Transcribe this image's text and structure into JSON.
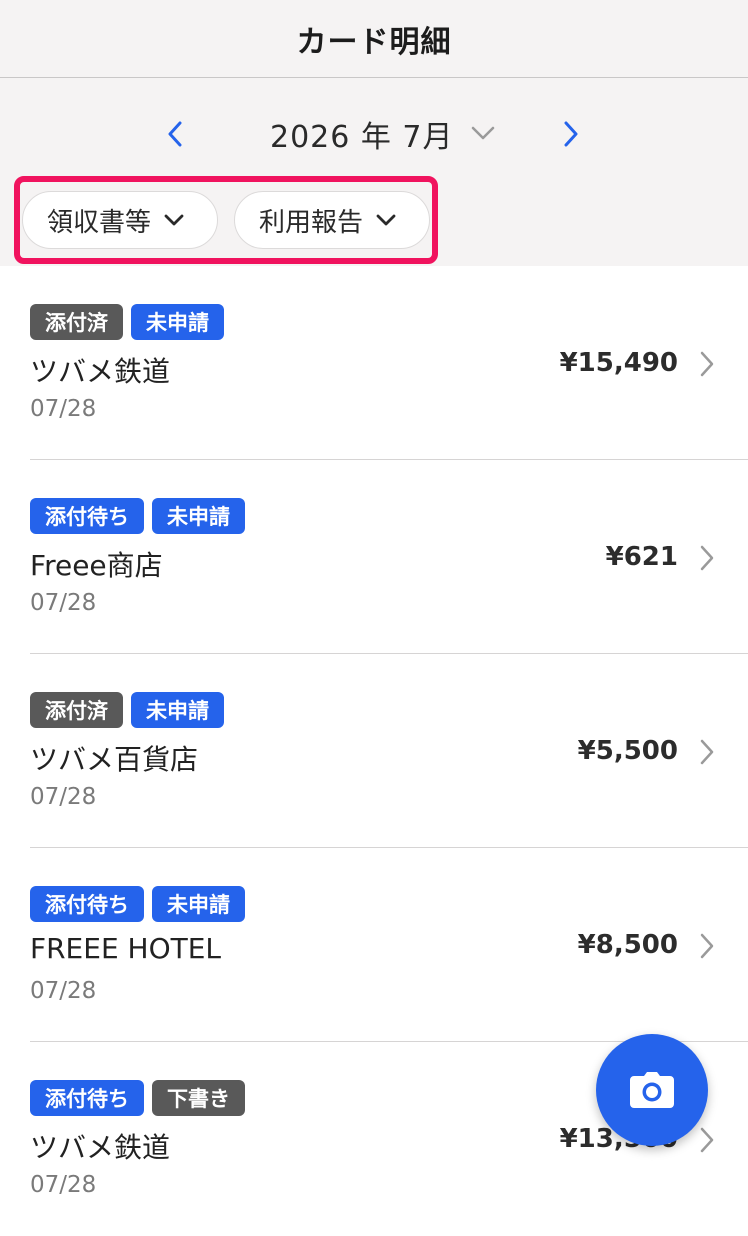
{
  "header": {
    "title": "カード明細"
  },
  "month_nav": {
    "label": "2026 年 7月",
    "prev_icon": "chevron-left-icon",
    "next_icon": "chevron-right-icon",
    "dropdown_icon": "chevron-down-icon"
  },
  "filters": [
    {
      "label": "領収書等"
    },
    {
      "label": "利用報告"
    }
  ],
  "transactions": [
    {
      "badges": [
        {
          "label": "添付済",
          "color": "#595959"
        },
        {
          "label": "未申請",
          "color": "#2563eb"
        }
      ],
      "merchant": "ツバメ鉄道",
      "date": "07/28",
      "amount": "¥15,490"
    },
    {
      "badges": [
        {
          "label": "添付待ち",
          "color": "#2563eb"
        },
        {
          "label": "未申請",
          "color": "#2563eb"
        }
      ],
      "merchant": "Freee商店",
      "date": "07/28",
      "amount": "¥621"
    },
    {
      "badges": [
        {
          "label": "添付済",
          "color": "#595959"
        },
        {
          "label": "未申請",
          "color": "#2563eb"
        }
      ],
      "merchant": "ツバメ百貨店",
      "date": "07/28",
      "amount": "¥5,500"
    },
    {
      "badges": [
        {
          "label": "添付待ち",
          "color": "#2563eb"
        },
        {
          "label": "未申請",
          "color": "#2563eb"
        }
      ],
      "merchant": "FREEE HOTEL",
      "date": "07/28",
      "amount": "¥8,500"
    },
    {
      "badges": [
        {
          "label": "添付待ち",
          "color": "#2563eb"
        },
        {
          "label": "下書き",
          "color": "#595959"
        }
      ],
      "merchant": "ツバメ鉄道",
      "date": "07/28",
      "amount": "¥13,500"
    }
  ],
  "fab": {
    "icon": "camera-icon"
  },
  "colors": {
    "accent": "#2563eb",
    "badge_gray": "#595959",
    "highlight": "#f0135e",
    "header_bg": "#f5f3f3"
  }
}
